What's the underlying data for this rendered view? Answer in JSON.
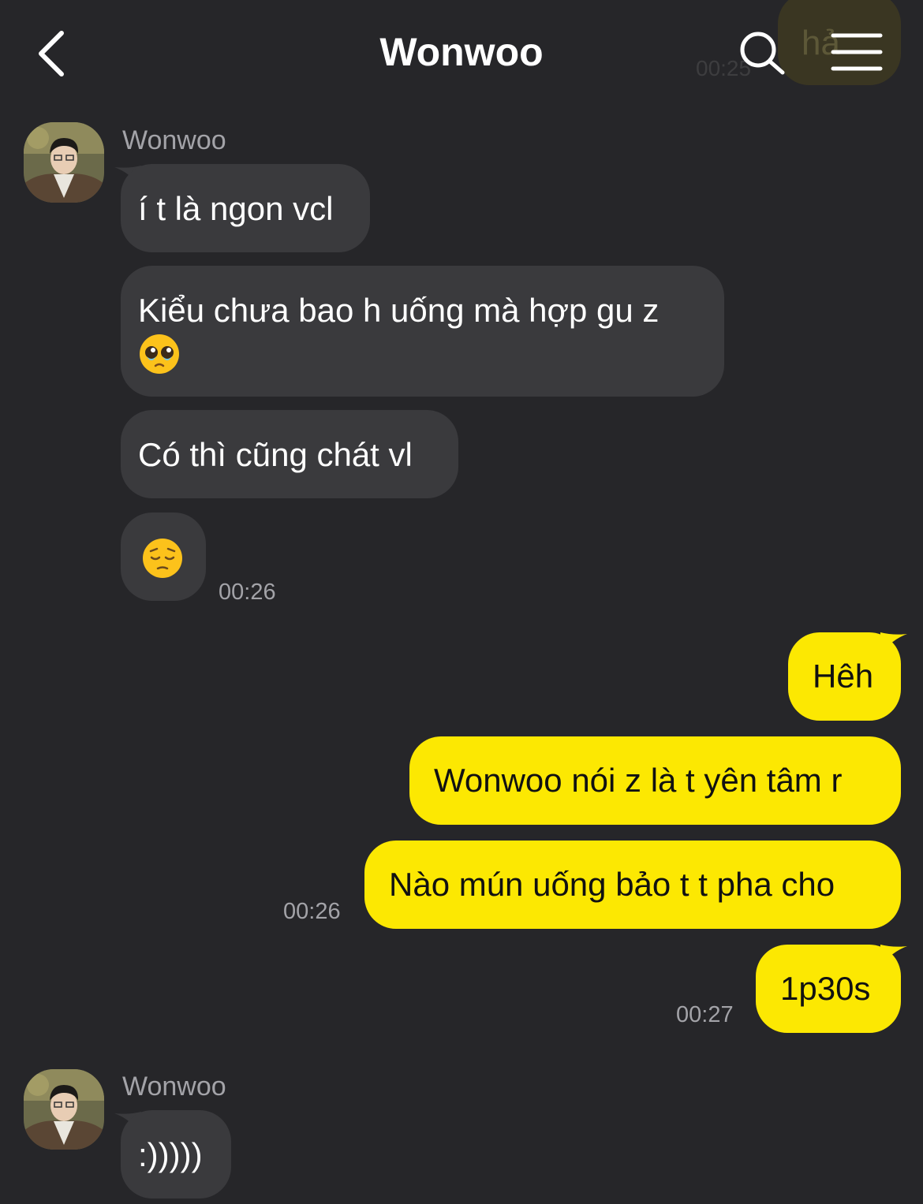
{
  "header": {
    "title": "Wonwoo",
    "back_icon": "chevron-left-icon",
    "search_icon": "search-icon",
    "menu_icon": "menu-icon"
  },
  "peek": {
    "text": "hả",
    "time": "00:25"
  },
  "colors": {
    "background": "#262629",
    "incoming_bubble": "#3a3a3d",
    "outgoing_bubble": "#fce802",
    "timestamp": "#a3a3a8"
  },
  "messages": {
    "group1": {
      "sender": "Wonwoo",
      "m1": "í t là ngon vcl",
      "m2_line1": "Kiểu chưa bao h uống mà hợp gu z",
      "m2_emoji": "pleading-face-emoji",
      "m3": "Có thì cũng chát vl",
      "m4_emoji": "pensive-face-emoji",
      "time": "00:26"
    },
    "group2": {
      "m1": "Hêh",
      "m2": "Wonwoo nói z là t yên tâm r",
      "m3": "Nào mún uống bảo t t pha cho",
      "time1": "00:26",
      "m4": "1p30s",
      "time2": "00:27"
    },
    "group3": {
      "sender": "Wonwoo",
      "m1": ":)))))"
    }
  }
}
